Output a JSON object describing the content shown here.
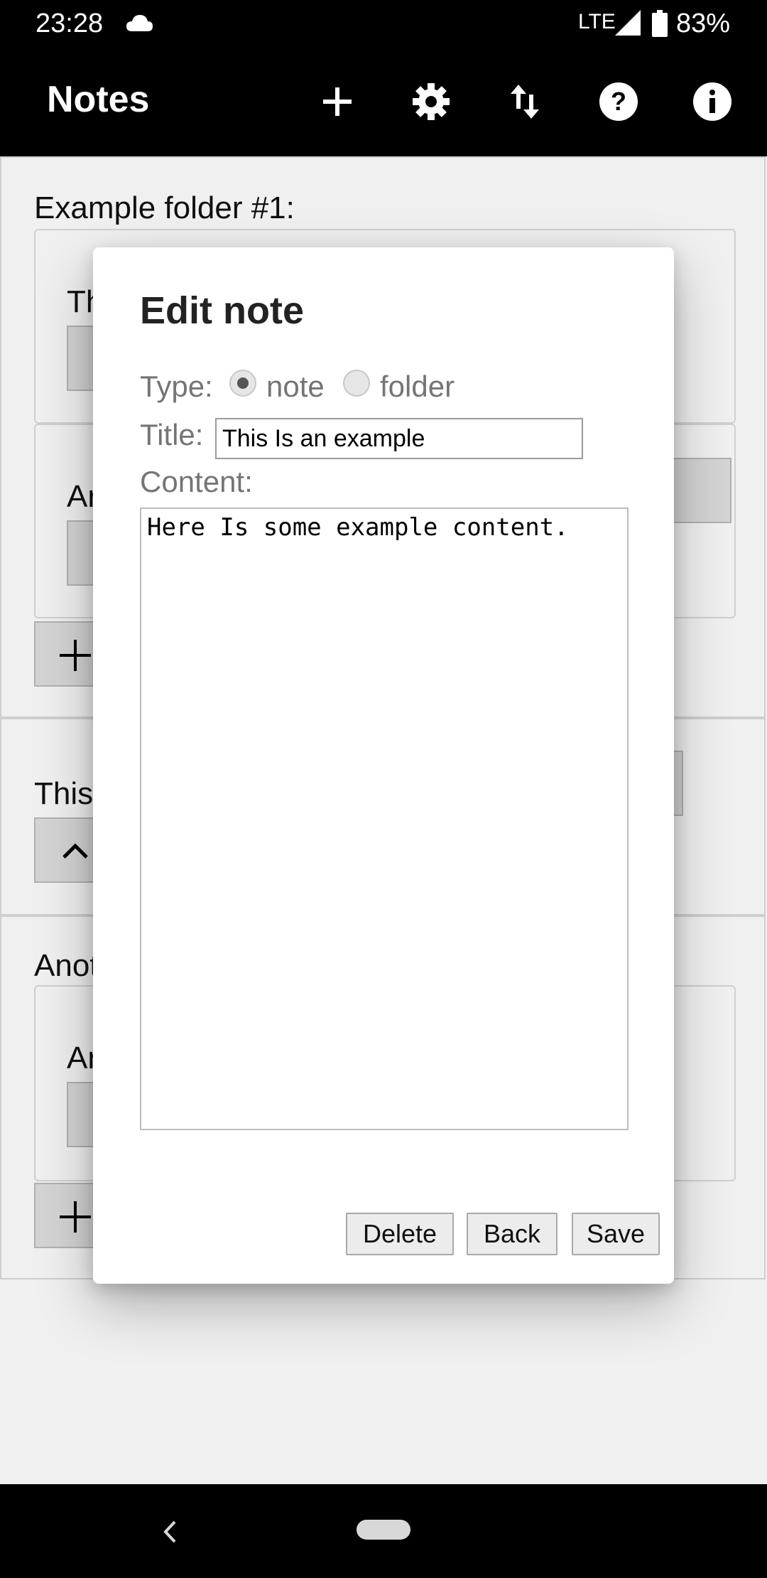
{
  "status_bar": {
    "time": "23:28",
    "network": "LTE",
    "battery": "83%",
    "icons": [
      "cloud-icon",
      "signal-icon",
      "battery-icon"
    ]
  },
  "app_bar": {
    "title": "Notes",
    "actions": [
      "add-icon",
      "settings-icon",
      "sort-icon",
      "help-icon",
      "info-icon"
    ]
  },
  "background": {
    "folder1_label": "Example folder #1:",
    "folder1_note1_partial": "Th",
    "folder1_note2_partial": "Ar",
    "note_partial": "This",
    "folder2_partial": "Anot",
    "folder2_note_partial": "Ar"
  },
  "dialog": {
    "title": "Edit note",
    "type_label": "Type:",
    "type_options": [
      "note",
      "folder"
    ],
    "type_selected": "note",
    "title_label": "Title:",
    "title_value": "This Is an example",
    "content_label": "Content:",
    "content_value": "Here Is some example content.",
    "buttons": {
      "delete": "Delete",
      "back": "Back",
      "save": "Save"
    }
  },
  "colors": {
    "bar_background": "#000000",
    "page_background": "#ffffff",
    "label_gray": "#757575"
  }
}
